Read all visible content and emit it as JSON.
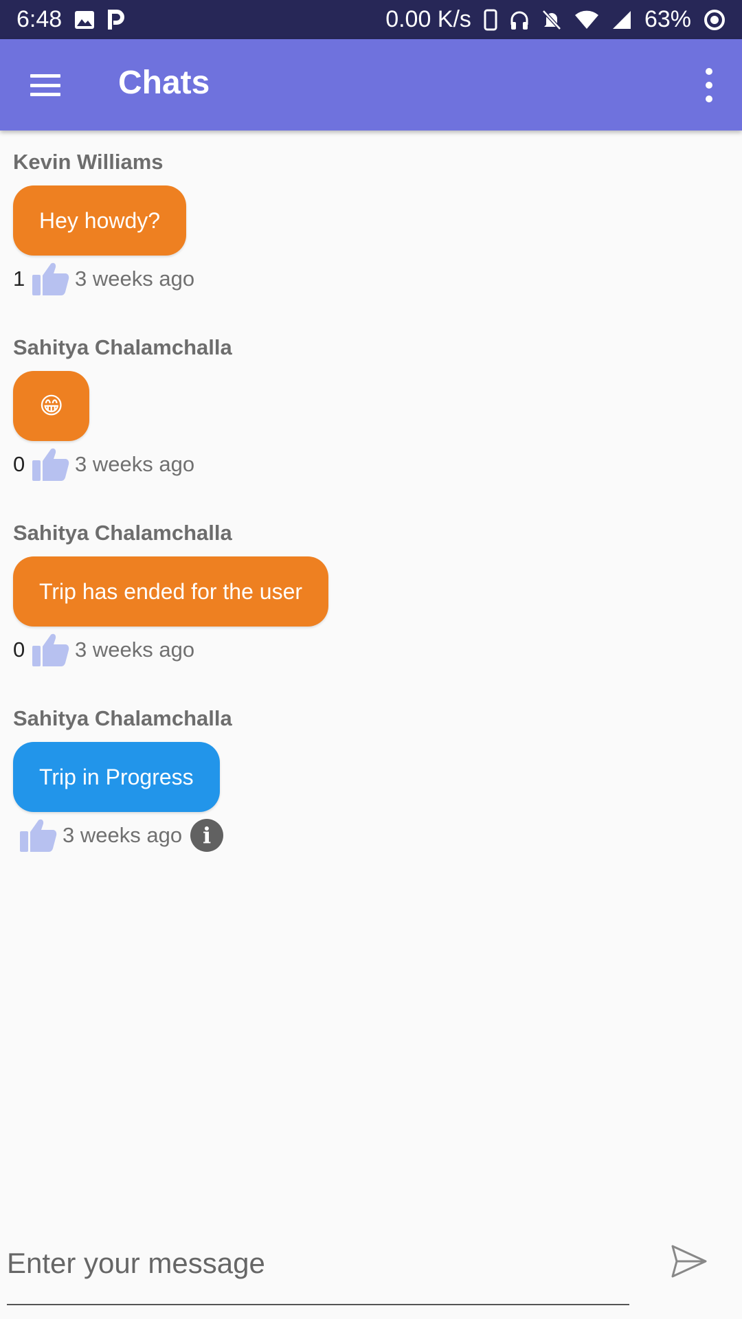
{
  "status_bar": {
    "time": "6:48",
    "net_speed": "0.00 K/s",
    "battery": "63%"
  },
  "app_bar": {
    "title": "Chats"
  },
  "messages": [
    {
      "sender": "Kevin Williams",
      "text": "Hey howdy?",
      "likes": "1",
      "time": "3 weeks ago",
      "color": "#ee8021"
    },
    {
      "sender": "Sahitya Chalamchalla",
      "text": "😁",
      "likes": "0",
      "time": "3 weeks ago",
      "color": "#ee8021"
    },
    {
      "sender": "Sahitya Chalamchalla",
      "text": "Trip has ended for the user",
      "likes": "0",
      "time": "3 weeks ago",
      "color": "#ee8021"
    },
    {
      "sender": "Sahitya Chalamchalla",
      "text": "Trip in Progress",
      "likes": "",
      "time": "3 weeks ago",
      "color": "#2295ea"
    }
  ],
  "composer": {
    "placeholder": "Enter your message"
  },
  "colors": {
    "status_bar": "#272757",
    "app_bar": "#6f72dd",
    "bubble_orange": "#ee8021",
    "bubble_blue": "#2295ea",
    "thumb": "#b7c1f0"
  }
}
